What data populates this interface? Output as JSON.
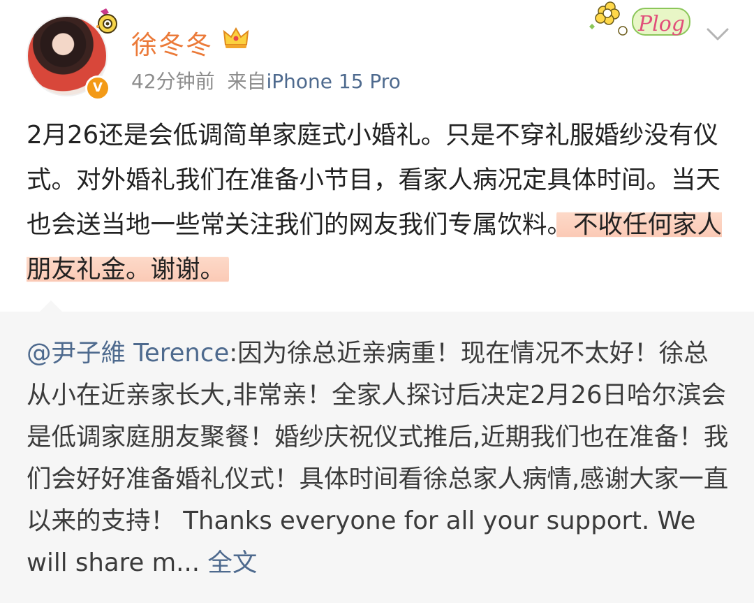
{
  "post": {
    "author": {
      "name": "徐冬冬",
      "avatar_icon": "avatar",
      "verified_icon": "verified-badge-icon",
      "badge_icon": "crown-icon"
    },
    "meta": {
      "time": "42分钟前",
      "source_prefix": "来自",
      "device": "iPhone 15 Pro"
    },
    "sticker_text": "Plog",
    "menu_icon": "chevron-down-icon",
    "text_main": "2月26还是会低调简单家庭式小婚礼。只是不穿礼服婚纱没有仪式。对外婚礼我们在准备小节目，看家人病况定具体时间。当天也会送当地一些常关注我们的网友我们专属饮料。",
    "text_highlight": "不收任何家人朋友礼金。谢谢。",
    "highlight_color": "#fbcab6"
  },
  "repost": {
    "mention": "@尹子維 Terence",
    "text": ":因为徐总近亲病重！现在情况不太好！徐总从小在近亲家长大,非常亲！全家人探讨后决定2月26日哈尔滨会是低调家庭朋友聚餐！婚纱庆祝仪式推后,近期我们也在准备！我们会好好准备婚礼仪式！具体时间看徐总家人病情,感谢大家一直以来的支持！ Thanks everyone for all your support.  We will share m...",
    "expand_label": "全文"
  },
  "colors": {
    "username": "#eb7a39",
    "link": "#4e6a8e",
    "meta": "#8d8d8d",
    "repost_bg": "#f6f6f6"
  }
}
